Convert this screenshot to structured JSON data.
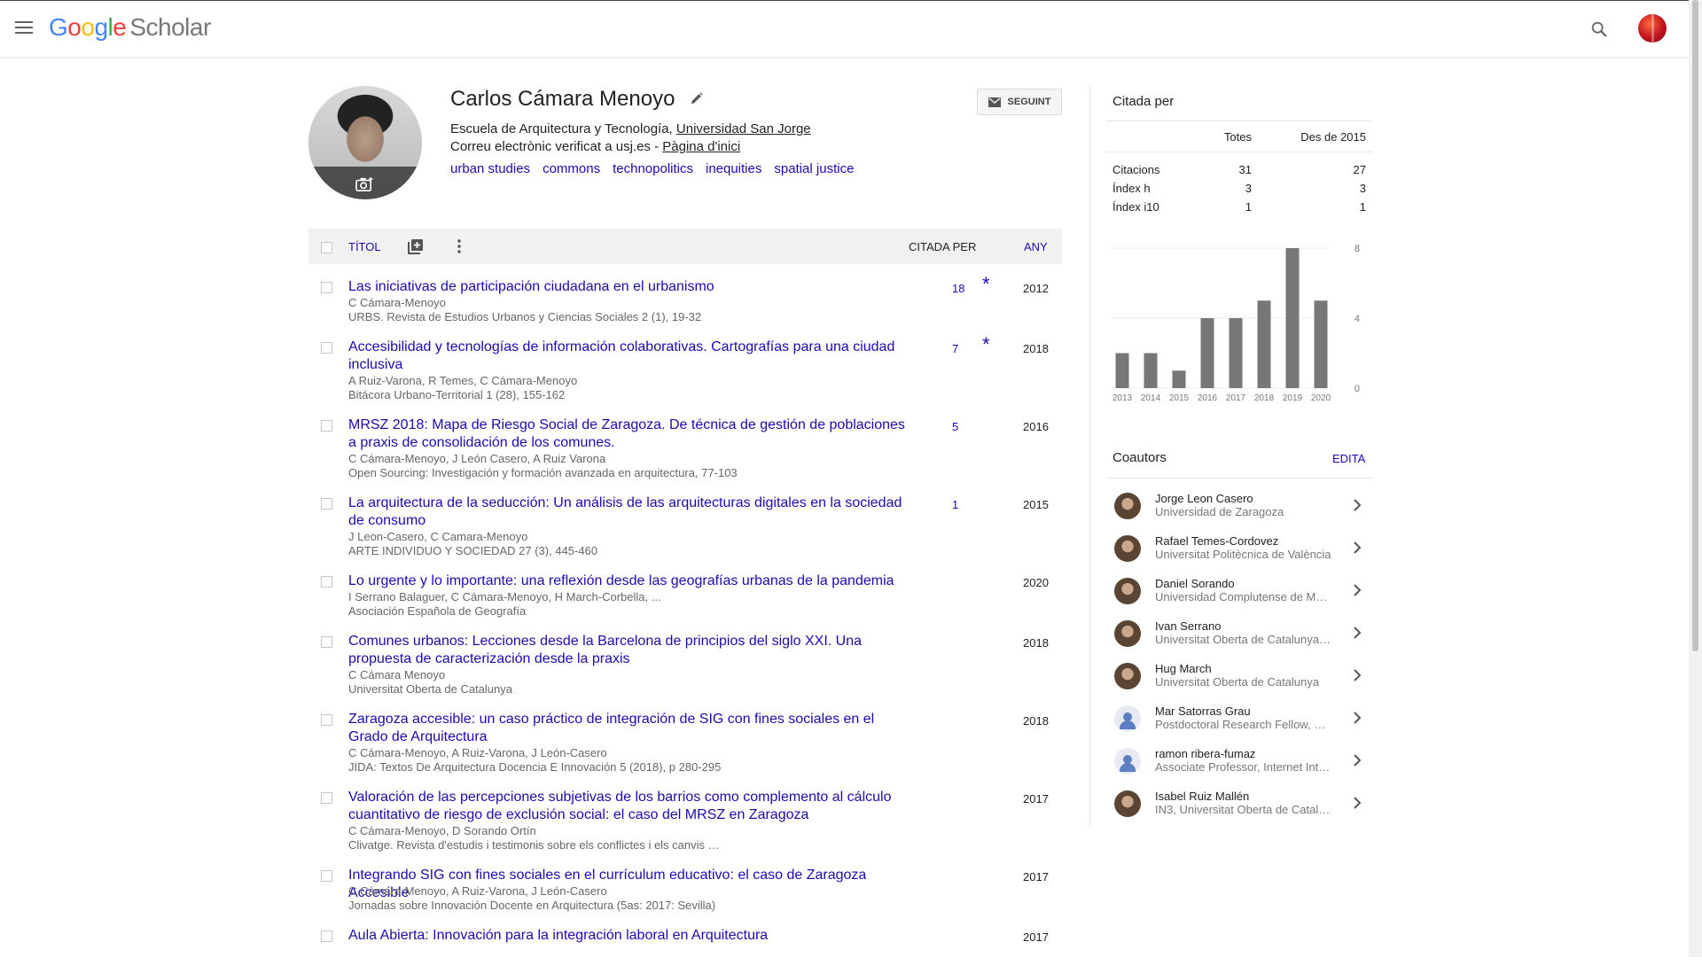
{
  "header": {
    "logo_google": [
      "G",
      "o",
      "o",
      "g",
      "l",
      "e"
    ],
    "logo_scholar": "Scholar",
    "icons": {
      "menu": "hamburger-icon",
      "search": "search-icon",
      "account": "account-avatar"
    }
  },
  "profile": {
    "name": "Carlos Cámara Menoyo",
    "affiliation_prefix": "Escuela de Arquitectura y Tecnología, ",
    "affiliation_link": "Universidad San Jorge",
    "email_prefix": "Correu electrònic verificat a usj.es - ",
    "homepage_link": "Pàgina d'inici",
    "interests": [
      "urban studies",
      "commons",
      "technopolitics",
      "inequities",
      "spatial justice"
    ],
    "follow_label": "SEGUINT"
  },
  "table": {
    "col_title": "TÍTOL",
    "col_cited": "CITADA PER",
    "col_year": "ANY",
    "rows": [
      {
        "title": "Las iniciativas de participación ciudadana en el urbanismo",
        "authors": "C Cámara-Menoyo",
        "venue": "URBS. Revista de Estudios Urbanos y Ciencias Sociales 2 (1), 19-32",
        "cites": "18",
        "star": "*",
        "year": "2012"
      },
      {
        "title": "Accesibilidad y tecnologías de información colaborativas. Cartografías para una ciudad inclusiva",
        "authors": "A Ruiz-Varona, R Temes, C Cámara-Menoyo",
        "venue": "Bitácora Urbano-Territorial 1 (28), 155-162",
        "cites": "7",
        "star": "*",
        "year": "2018"
      },
      {
        "title": "MRSZ 2018: Mapa de Riesgo Social de Zaragoza. De técnica de gestión de poblaciones a praxis de consolidación de los comunes.",
        "authors": "C Cámara-Menoyo, J León Casero, A Ruiz Varona",
        "venue": "Open Sourcing: Investigación y formación avanzada en arquitectura, 77-103",
        "cites": "5",
        "star": "",
        "year": "2016"
      },
      {
        "title": "La arquitectura de la seducción: Un análisis de las arquitecturas digitales en la sociedad de consumo",
        "authors": "J Leon-Casero, C Camara-Menoyo",
        "venue": "ARTE INDIVIDUO Y SOCIEDAD 27 (3), 445-460",
        "cites": "1",
        "star": "",
        "year": "2015"
      },
      {
        "title": "Lo urgente y lo importante: una reflexión desde las geografías urbanas de la pandemia",
        "authors": "I Serrano Balaguer, C Cámara-Menoyo, H March-Corbella, ...",
        "venue": "Asociación Española de Geografía",
        "cites": "",
        "star": "",
        "year": "2020"
      },
      {
        "title": "Comunes urbanos: Lecciones desde la Barcelona de principios del siglo XXI. Una propuesta de caracterización desde la praxis",
        "authors": "C Cámara Menoyo",
        "venue": "Universitat Oberta de Catalunya",
        "cites": "",
        "star": "",
        "year": "2018"
      },
      {
        "title": "Zaragoza accesible: un caso práctico de integración de SIG con fines sociales en el Grado de Arquitectura",
        "authors": "C Cámara-Menoyo, A Ruiz-Varona, J León-Casero",
        "venue": "JIDA: Textos De Arquitectura Docencia E Innovación 5 (2018), p 280-295",
        "cites": "",
        "star": "",
        "year": "2018"
      },
      {
        "title": "Valoración de las percepciones subjetivas de los barrios como complemento al cálculo cuantitativo de riesgo de exclusión social: el caso del MRSZ en Zaragoza",
        "authors": "C Cámara-Menoyo, D Sorando Ortín",
        "venue": "Clivatge. Revista d'estudis i testimonis sobre els conflictes i els canvis …",
        "cites": "",
        "star": "",
        "year": "2017"
      },
      {
        "title": "Integrando SIG con fines sociales en el currículum educativo: el caso de Zaragoza Accesible",
        "authors": "C Cámara-Menoyo, A Ruiz-Varona, J León-Casero",
        "venue": "Jornadas sobre Innovación Docente en Arquitectura (5as: 2017: Sevilla)",
        "cites": "",
        "star": "",
        "year": "2017"
      },
      {
        "title": "Aula Abierta: Innovación para la integración laboral en Arquitectura",
        "authors": "",
        "venue": "",
        "cites": "",
        "star": "",
        "year": "2017"
      }
    ]
  },
  "cited_by": {
    "title": "Citada per",
    "col_all": "Totes",
    "col_since": "Des de 2015",
    "rows": [
      {
        "label": "Citacions",
        "all": "31",
        "since": "27"
      },
      {
        "label": "Índex h",
        "all": "3",
        "since": "3"
      },
      {
        "label": "Índex i10",
        "all": "1",
        "since": "1"
      }
    ]
  },
  "chart_data": {
    "type": "bar",
    "categories": [
      "2013",
      "2014",
      "2015",
      "2016",
      "2017",
      "2018",
      "2019",
      "2020"
    ],
    "values": [
      2,
      2,
      1,
      4,
      4,
      5,
      8,
      5
    ],
    "ylim": [
      0,
      8
    ],
    "yticks": [
      "0",
      "4",
      "8"
    ],
    "bar_color": "#777777",
    "grid": true
  },
  "coauthors": {
    "title": "Coautors",
    "edit_label": "EDITA",
    "items": [
      {
        "name": "Jorge Leon Casero",
        "affil": "Universidad de Zaragoza",
        "avatar": "photo"
      },
      {
        "name": "Rafael Temes-Cordovez",
        "affil": "Universitat Politècnica de València",
        "avatar": "photo"
      },
      {
        "name": "Daniel Sorando",
        "affil": "Universidad Complutense de Ma…",
        "avatar": "photo"
      },
      {
        "name": "Ivan Serrano",
        "affil": "Universitat Oberta de Catalunya …",
        "avatar": "photo"
      },
      {
        "name": "Hug March",
        "affil": "Universitat Oberta de Catalunya",
        "avatar": "photo"
      },
      {
        "name": "Mar Satorras Grau",
        "affil": "Postdoctoral Research Fellow, U…",
        "avatar": "default"
      },
      {
        "name": "ramon ribera-fumaz",
        "affil": "Associate Professor, Internet Int…",
        "avatar": "default"
      },
      {
        "name": "Isabel Ruiz Mallén",
        "affil": "IN3, Universitat Oberta de Catal…",
        "avatar": "photo"
      }
    ]
  },
  "colors": {
    "link": "#1a0dab",
    "muted": "#666666"
  }
}
